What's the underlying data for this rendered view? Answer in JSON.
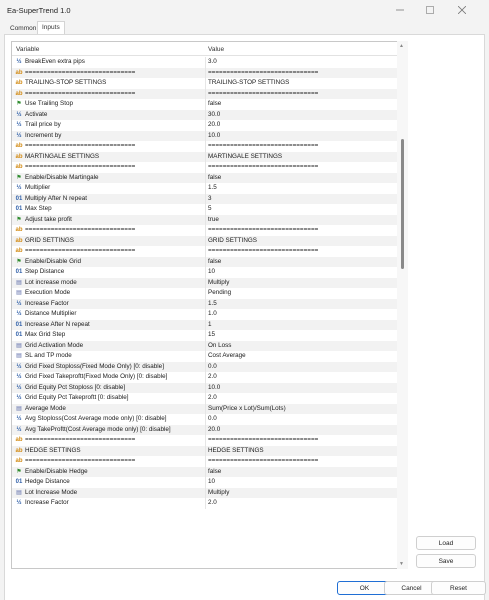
{
  "window": {
    "title": "Ea-SuperTrend 1.0"
  },
  "tabs": [
    {
      "label": "Common"
    },
    {
      "label": "Inputs"
    }
  ],
  "grid": {
    "columns": {
      "variable": "Variable",
      "value": "Value"
    },
    "rows": [
      {
        "icon": "v2",
        "name": "BreakEven extra pips",
        "value": "3.0"
      },
      {
        "icon": "ab",
        "name": "==============================",
        "value": "=============================="
      },
      {
        "icon": "ab",
        "name": "TRAILING-STOP SETTINGS",
        "value": "TRAILING-STOP SETTINGS"
      },
      {
        "icon": "ab",
        "name": "==============================",
        "value": "=============================="
      },
      {
        "icon": "flag",
        "name": "Use Trailing Stop",
        "value": "false"
      },
      {
        "icon": "v2",
        "name": "Activate",
        "value": "30.0"
      },
      {
        "icon": "v2",
        "name": "Trail price by",
        "value": "20.0"
      },
      {
        "icon": "v2",
        "name": "Increment by",
        "value": "10.0"
      },
      {
        "icon": "ab",
        "name": "==============================",
        "value": "=============================="
      },
      {
        "icon": "ab",
        "name": "MARTINGALE SETTINGS",
        "value": "MARTINGALE SETTINGS"
      },
      {
        "icon": "ab",
        "name": "==============================",
        "value": "=============================="
      },
      {
        "icon": "flag",
        "name": "Enable/Disable Martingale",
        "value": "false"
      },
      {
        "icon": "v2",
        "name": "Multiplier",
        "value": "1.5"
      },
      {
        "icon": "01",
        "name": "Multiply After N repeat",
        "value": "3"
      },
      {
        "icon": "01",
        "name": "Max Step",
        "value": "5"
      },
      {
        "icon": "flag",
        "name": "Adjust take profit",
        "value": "true"
      },
      {
        "icon": "ab",
        "name": "==============================",
        "value": "=============================="
      },
      {
        "icon": "ab",
        "name": "GRID SETTINGS",
        "value": "GRID SETTINGS"
      },
      {
        "icon": "ab",
        "name": "==============================",
        "value": "=============================="
      },
      {
        "icon": "flag",
        "name": "Enable/Disable Grid",
        "value": "false"
      },
      {
        "icon": "01",
        "name": "Step Distance",
        "value": "10"
      },
      {
        "icon": "list",
        "name": "Lot increase mode",
        "value": "Multiply"
      },
      {
        "icon": "list",
        "name": "Execution Mode",
        "value": "Pending"
      },
      {
        "icon": "v2",
        "name": "Increase Factor",
        "value": "1.5"
      },
      {
        "icon": "v2",
        "name": "Distance Multiplier",
        "value": "1.0"
      },
      {
        "icon": "01",
        "name": "Increase After N repeat",
        "value": "1"
      },
      {
        "icon": "01",
        "name": "Max Grid Step",
        "value": "15"
      },
      {
        "icon": "list",
        "name": "Grid Activation Mode",
        "value": "On Loss"
      },
      {
        "icon": "list",
        "name": "SL and TP mode",
        "value": "Cost Average"
      },
      {
        "icon": "v2",
        "name": "Grid Fixed Stoploss(Fixed Mode Only) [0: disable]",
        "value": "0.0"
      },
      {
        "icon": "v2",
        "name": "Grid Fixed Takeproftt(Fixed Mode Only) [0: disable]",
        "value": "2.0"
      },
      {
        "icon": "v2",
        "name": "Grid Equity Pct Stoploss [0: disable]",
        "value": "10.0"
      },
      {
        "icon": "v2",
        "name": "Grid Equity Pct Takeproftt [0: disable]",
        "value": "2.0"
      },
      {
        "icon": "list",
        "name": "Average Mode",
        "value": "Sum(Price x Lot)/Sum(Lots)"
      },
      {
        "icon": "v2",
        "name": "Avg Stoploss(Cost Average mode only) [0: disable]",
        "value": "0.0"
      },
      {
        "icon": "v2",
        "name": "Avg TakeProftt(Cost Average mode only) [0: disable]",
        "value": "20.0"
      },
      {
        "icon": "ab",
        "name": "==============================",
        "value": "=============================="
      },
      {
        "icon": "ab",
        "name": "HEDGE SETTINGS",
        "value": "HEDGE SETTINGS"
      },
      {
        "icon": "ab",
        "name": "==============================",
        "value": "=============================="
      },
      {
        "icon": "flag",
        "name": "Enable/Disable Hedge",
        "value": "false"
      },
      {
        "icon": "01",
        "name": "Hedge Distance",
        "value": "10"
      },
      {
        "icon": "list",
        "name": "Lot Increase Mode",
        "value": "Multiply"
      },
      {
        "icon": "v2",
        "name": "Increase Factor",
        "value": "2.0"
      }
    ]
  },
  "buttons": {
    "load": "Load",
    "save": "Save",
    "ok": "OK",
    "cancel": "Cancel",
    "reset": "Reset"
  },
  "icons": {
    "ab": "ab",
    "v2": "½",
    "01": "01",
    "flag": "⚑",
    "list": "▤"
  }
}
